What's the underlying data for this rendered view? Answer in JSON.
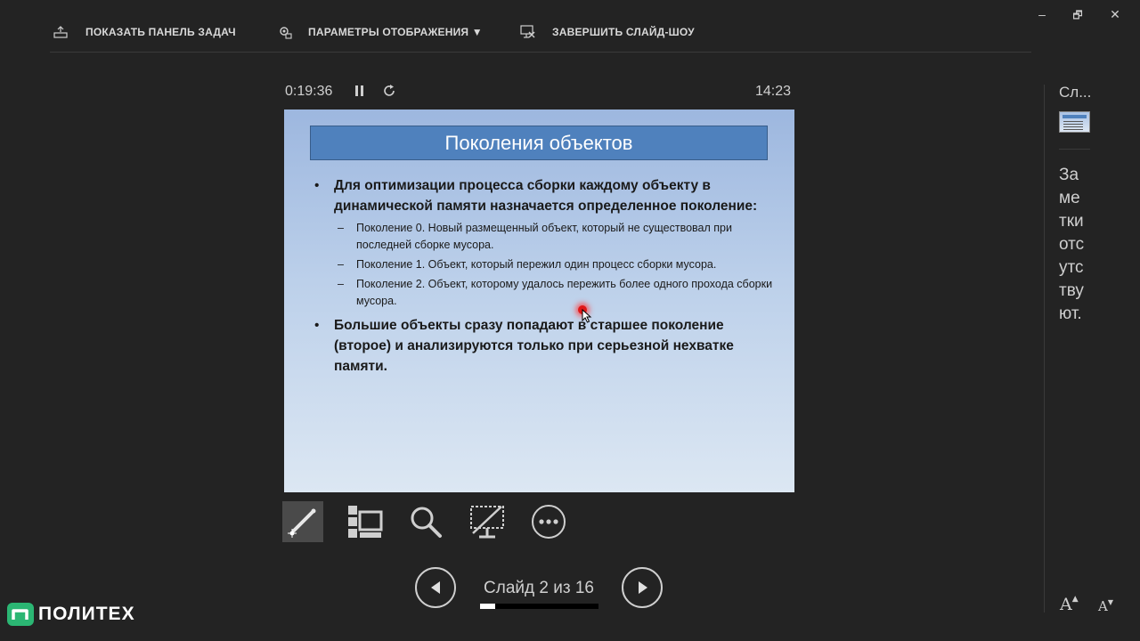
{
  "toolbar": {
    "show_taskbar": "ПОКАЗАТЬ ПАНЕЛЬ ЗАДАЧ",
    "display_settings": "ПАРАМЕТРЫ ОТОБРАЖЕНИЯ ▼",
    "end_slideshow": "ЗАВЕРШИТЬ СЛАЙД-ШОУ"
  },
  "window_controls": {
    "minimize": "–",
    "restore": "🗗",
    "close": "✕"
  },
  "presenter": {
    "elapsed_time": "0:19:36",
    "clock": "14:23",
    "slide_counter": "Слайд 2 из 16",
    "progress_fraction": 0.125
  },
  "slide": {
    "title": "Поколения объектов",
    "bullet1": "Для оптимизации процесса сборки каждому объекту в динамической памяти назначается определенное поколение:",
    "sub_items": [
      "Поколение 0. Новый размещенный объект, который не существовал при последней сборке мусора.",
      "Поколение 1. Объект, который пережил один процесс сборки мусора.",
      "Поколение 2.  Объект, которому удалось пережить более одного прохода сборки мусора."
    ],
    "bullet2": "Большие объекты сразу попадают в старшее поколение (второе) и анализируются только при серьезной нехватке памяти."
  },
  "tools": [
    "pen-laser-tool",
    "see-all-slides",
    "zoom-into-slide",
    "black-screen",
    "more-options"
  ],
  "side_panel": {
    "next_label": "Сл...",
    "notes_text": "Заметки отсутствуют."
  },
  "font_controls": {
    "increase": "A",
    "decrease": "A"
  },
  "logo": {
    "text": "ПОЛИТЕХ"
  },
  "colors": {
    "background": "#232323",
    "slide_title": "#4f81bd",
    "logo_green": "#2bb673",
    "laser": "#e01818"
  }
}
